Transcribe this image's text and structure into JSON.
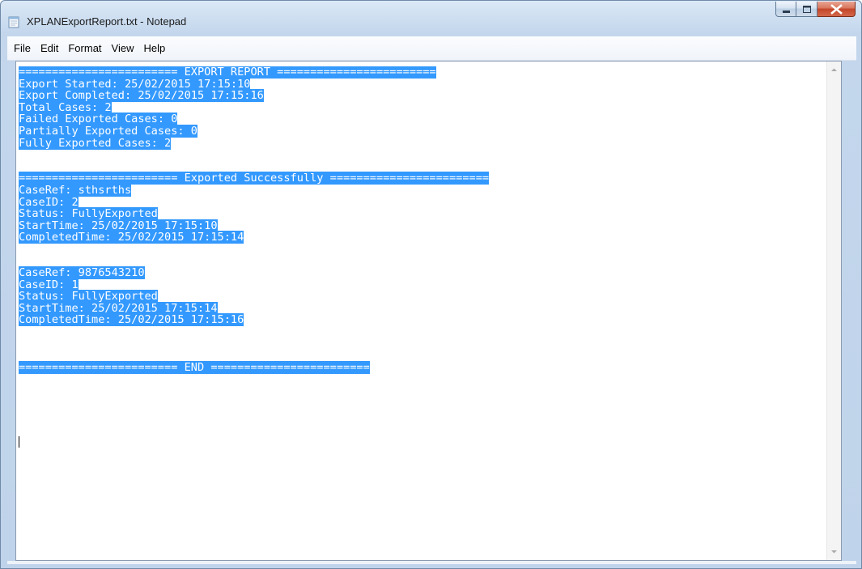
{
  "window": {
    "title": "XPLANExportReport.txt - Notepad"
  },
  "menu": {
    "items": [
      {
        "label": "File"
      },
      {
        "label": "Edit"
      },
      {
        "label": "Format"
      },
      {
        "label": "View"
      },
      {
        "label": "Help"
      }
    ]
  },
  "document": {
    "lines": [
      "======================== EXPORT REPORT ========================",
      "Export Started: 25/02/2015 17:15:10",
      "Export Completed: 25/02/2015 17:15:16",
      "Total Cases: 2",
      "Failed Exported Cases: 0",
      "Partially Exported Cases: 0",
      "Fully Exported Cases: 2",
      "",
      "",
      "======================== Exported Successfully ========================",
      "CaseRef: sthsrths",
      "CaseID: 2",
      "Status: FullyExported",
      "StartTime: 25/02/2015 17:15:10",
      "CompletedTime: 25/02/2015 17:15:14",
      "",
      "",
      "CaseRef: 9876543210",
      "CaseID: 1",
      "Status: FullyExported",
      "StartTime: 25/02/2015 17:15:14",
      "CompletedTime: 25/02/2015 17:15:16",
      "",
      "",
      "",
      "======================== END ========================"
    ]
  },
  "icons": {
    "app": "notepad-icon",
    "minimize": "minimize-icon",
    "maximize": "maximize-icon",
    "close": "close-icon",
    "scroll_up": "scroll-up-arrow-icon",
    "scroll_down": "scroll-down-arrow-icon"
  },
  "colors": {
    "selection": "#3399ff",
    "selection_text": "#ffffff",
    "close_button": "#c4462a"
  }
}
